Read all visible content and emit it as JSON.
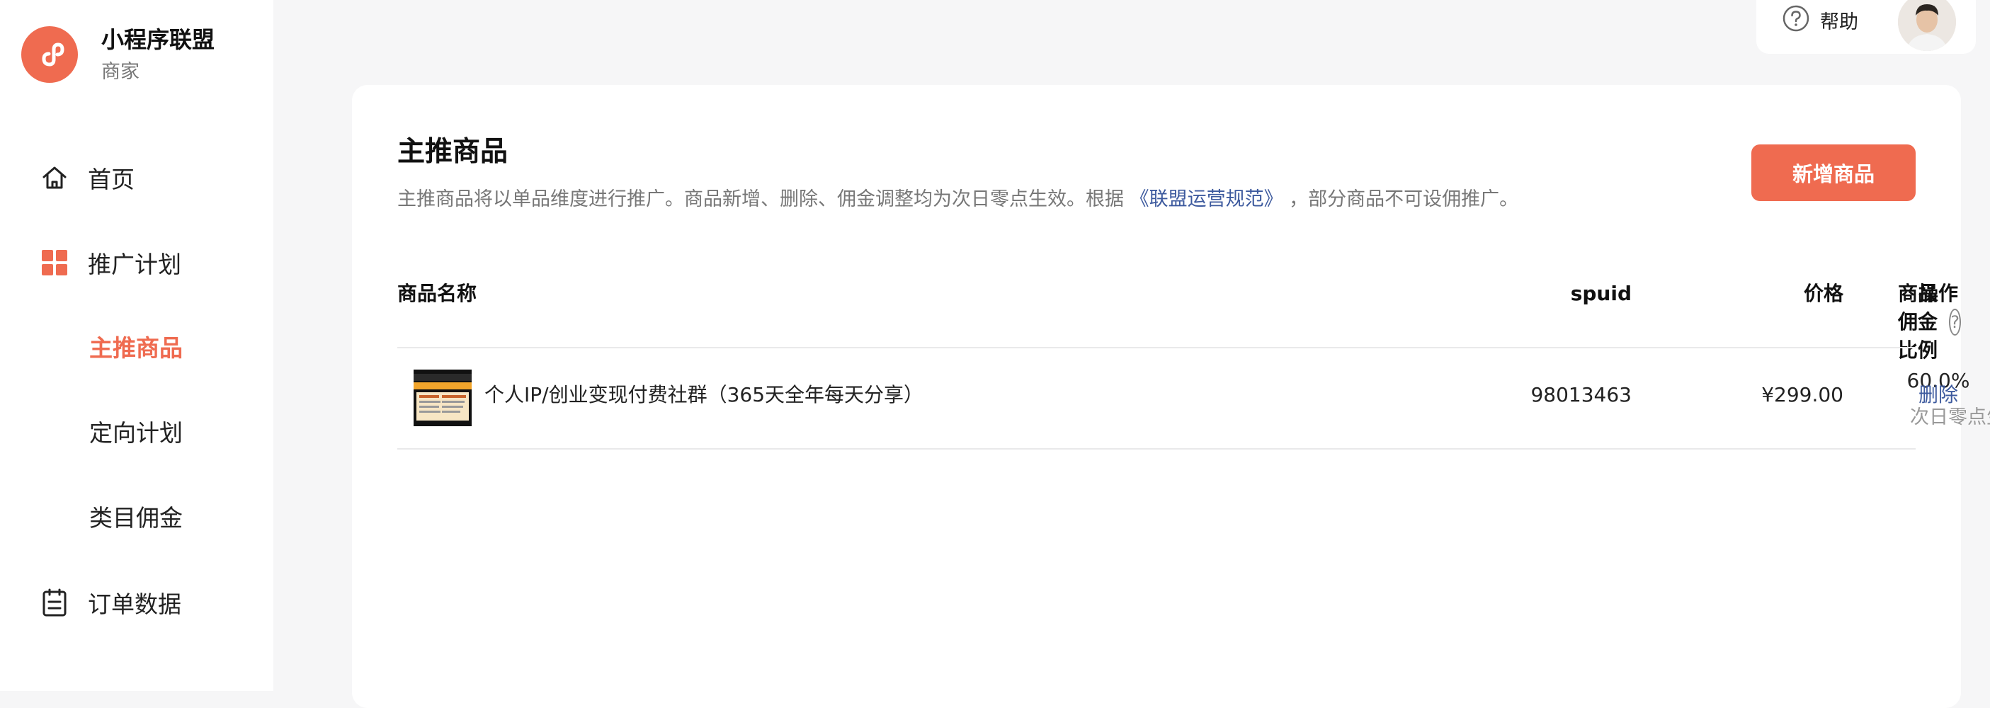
{
  "brand": {
    "title": "小程序联盟",
    "subtitle": "商家",
    "accent": "#ef6b50"
  },
  "sidebar": {
    "items": [
      {
        "label": "首页",
        "icon": "home-icon"
      },
      {
        "label": "推广计划",
        "icon": "grid-icon"
      },
      {
        "label": "主推商品",
        "active": true
      },
      {
        "label": "定向计划"
      },
      {
        "label": "类目佣金"
      },
      {
        "label": "订单数据",
        "icon": "clipboard-icon"
      }
    ]
  },
  "topbar": {
    "help_label": "帮助",
    "help_icon": "question-circle-icon"
  },
  "page": {
    "title": "主推商品",
    "desc_before": "主推商品将以单品维度进行推广。商品新增、删除、佣金调整均为次日零点生效。根据 ",
    "desc_link": "《联盟运营规范》",
    "desc_after": " ，部分商品不可设佣推广。",
    "add_button": "新增商品"
  },
  "table": {
    "headers": {
      "name": "商品名称",
      "spuid": "spuid",
      "price": "价格",
      "commission": "商品佣金比例",
      "operation": "操作"
    },
    "rows": [
      {
        "name": "个人IP/创业变现付费社群（365天全年每天分享）",
        "spuid": "98013463",
        "price": "¥299.00",
        "commission": "60.0%",
        "commission_note": "次日零点生效",
        "action": "删除"
      }
    ]
  },
  "colors": {
    "accent": "#ef6b50",
    "link": "#3d5a9e",
    "muted": "#777777"
  }
}
